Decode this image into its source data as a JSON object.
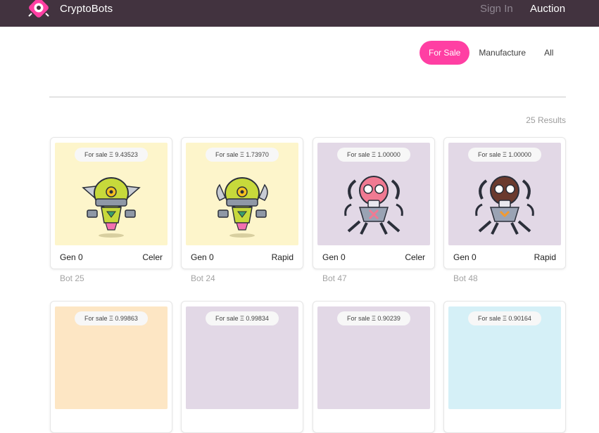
{
  "header": {
    "brand": "CryptoBots",
    "sign_in": "Sign In",
    "auction": "Auction"
  },
  "filters": {
    "items": [
      "For Sale",
      "Manufacture",
      "All"
    ],
    "selected": "For Sale"
  },
  "results": "25 Results",
  "cards": [
    {
      "price": "For sale Ξ 9.43523",
      "gen": "Gen 0",
      "trait": "Celer",
      "name": "Bot 25",
      "bg": "#fdf5cb",
      "robot": "yellow-green"
    },
    {
      "price": "For sale Ξ 1.73970",
      "gen": "Gen 0",
      "trait": "Rapid",
      "name": "Bot 24",
      "bg": "#fdf5cb",
      "robot": "yellow-green"
    },
    {
      "price": "For sale Ξ 1.00000",
      "gen": "Gen 0",
      "trait": "Celer",
      "name": "Bot 47",
      "bg": "#e2d8e6",
      "robot": "pink-spider"
    },
    {
      "price": "For sale Ξ 1.00000",
      "gen": "Gen 0",
      "trait": "Rapid",
      "name": "Bot 48",
      "bg": "#e2d8e6",
      "robot": "brown-spider"
    },
    {
      "price": "For sale Ξ 0.99863",
      "bg": "#fde6c4"
    },
    {
      "price": "For sale Ξ 0.99834",
      "bg": "#e2d8e6"
    },
    {
      "price": "For sale Ξ 0.90239",
      "bg": "#e2d8e6"
    },
    {
      "price": "For sale Ξ 0.90164",
      "bg": "#d5f0f7"
    }
  ],
  "colors": {
    "topbar": "#42333f",
    "accent": "#ff3fa3"
  }
}
